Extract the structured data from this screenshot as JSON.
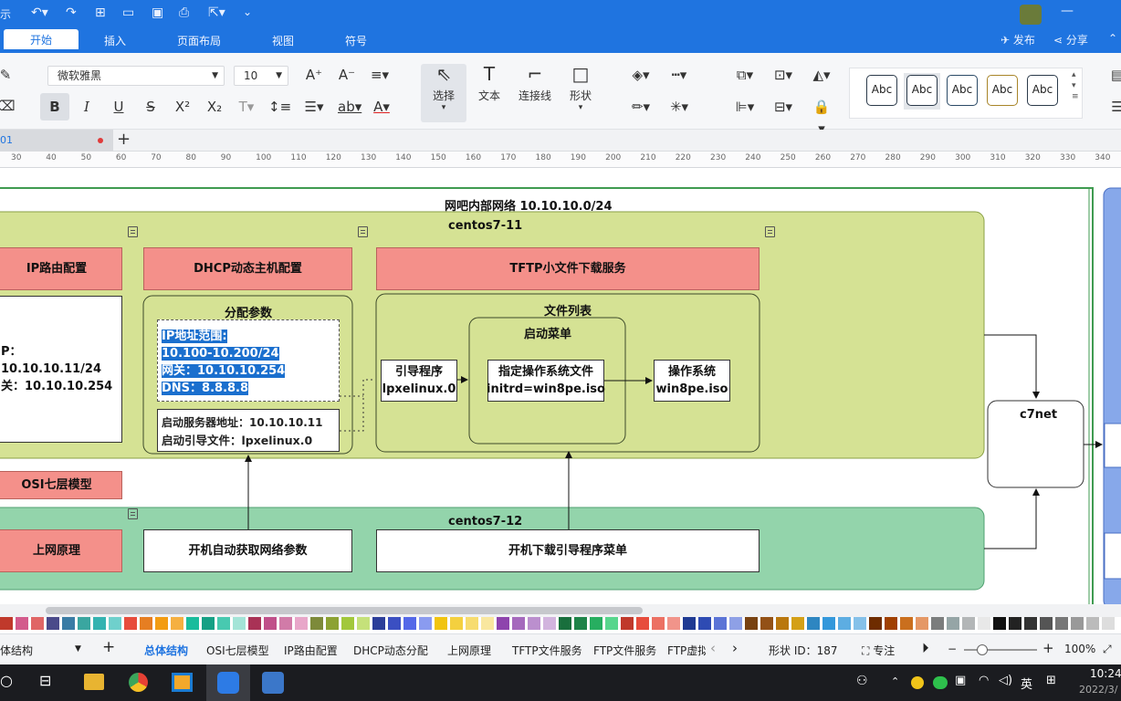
{
  "titlebar": {
    "left_fragment": "示",
    "publish": "发布",
    "share": "分享"
  },
  "ribbon_tabs": [
    "开始",
    "插入",
    "页面布局",
    "视图",
    "符号"
  ],
  "ribbon": {
    "font_family": "微软雅黑",
    "font_size": "10",
    "select": "选择",
    "text": "文本",
    "connector": "连接线",
    "shape": "形状",
    "style_preset": "Abc",
    "style_colors": [
      "#1f2b38",
      "#2a2a2a",
      "#2b4a66",
      "#a88528",
      "#2b3a4a"
    ]
  },
  "doc_tab": {
    "name": "01",
    "unsaved_dot_color": "#e03b3b"
  },
  "ruler_ticks": [
    "30",
    "40",
    "50",
    "60",
    "70",
    "80",
    "90",
    "100",
    "110",
    "120",
    "130",
    "140",
    "150",
    "160",
    "170",
    "180",
    "190",
    "200",
    "210",
    "220",
    "230",
    "240",
    "250",
    "260",
    "270",
    "280",
    "290",
    "300",
    "310",
    "320",
    "330",
    "340"
  ],
  "diagram": {
    "outer_title": "网吧内部网络 10.10.10.0/24",
    "centos11": {
      "title": "centos7-11",
      "ip_route": "IP路由配置",
      "left_lines": [
        "P：10.10.10.11/24",
        "关：10.10.10.254"
      ],
      "dhcp": "DHCP动态主机配置",
      "tftp": "TFTP小文件下载服务",
      "params_title": "分配参数",
      "params_selected": [
        "IP地址范围:",
        "10.100-10.200/24",
        "网关：10.10.10.254",
        "DNS：8.8.8.8"
      ],
      "boot_server": "启动服务器地址：10.10.10.11",
      "boot_file": "启动引导文件：lpxelinux.0",
      "file_list_title": "文件列表",
      "boot_menu_title": "启动菜单",
      "bootloader": [
        "引导程序",
        "lpxelinux.0"
      ],
      "os_file": [
        "指定操作系统文件",
        "initrd=win8pe.iso"
      ],
      "os": [
        "操作系统",
        "win8pe.iso"
      ]
    },
    "osi": "OSI七层模型",
    "centos12": {
      "title": "centos7-12",
      "internet_principle": "上网原理",
      "auto_get_params": "开机自动获取网络参数",
      "download_menu": "开机下载引导程序菜单"
    },
    "c7net": "c7net"
  },
  "palette_colors": [
    "#c0392b",
    "#d35b8c",
    "#e06666",
    "#4a4a8a",
    "#3a7ca5",
    "#3aa6a0",
    "#34b3b1",
    "#6fd0cc",
    "#e74c3c",
    "#e67e22",
    "#f39c12",
    "#f5b041",
    "#1abc9c",
    "#16a085",
    "#48c9b0",
    "#a3e4d7",
    "#a93256",
    "#c0508a",
    "#d17ba8",
    "#e8a6c9",
    "#7d8a3a",
    "#8ca233",
    "#a2c83b",
    "#c5e17a",
    "#2c3e9a",
    "#3b4fc2",
    "#5468e8",
    "#8a9bf0",
    "#f1c40f",
    "#f4d03f",
    "#f7dc6f",
    "#f9e79f",
    "#8e44ad",
    "#a569bd",
    "#bb8fce",
    "#d2b4de",
    "#196f3d",
    "#1e8449",
    "#27ae60",
    "#58d68d",
    "#c0392b",
    "#e74c3c",
    "#ec7063",
    "#f1948a",
    "#1f3a93",
    "#2e4bb3",
    "#5b74d6",
    "#8ea0e6",
    "#784212",
    "#935116",
    "#b9770e",
    "#d4a017",
    "#2e86c1",
    "#3498db",
    "#5dade2",
    "#85c1e9",
    "#6e2c00",
    "#a04000",
    "#ca6f1e",
    "#e59866",
    "#7b7d7d",
    "#95a5a6",
    "#b3b6b7",
    "#e8e8e8",
    "#111111",
    "#222222",
    "#333333",
    "#555555",
    "#777777",
    "#999999",
    "#bbbbbb",
    "#dddddd"
  ],
  "page_tabs": {
    "current": "体结构",
    "tabs": [
      "总体结构",
      "OSI七层模型",
      "IP路由配置",
      "DHCP动态分配",
      "上网原理",
      "TFTP文件服务",
      "FTP文件服务",
      "FTP虚拟"
    ],
    "shape_id_label": "形状 ID：187",
    "focus": "专注",
    "zoom": "100%"
  },
  "taskbar": {
    "ime": "英",
    "time": "10:24",
    "date": "2022/3/"
  }
}
